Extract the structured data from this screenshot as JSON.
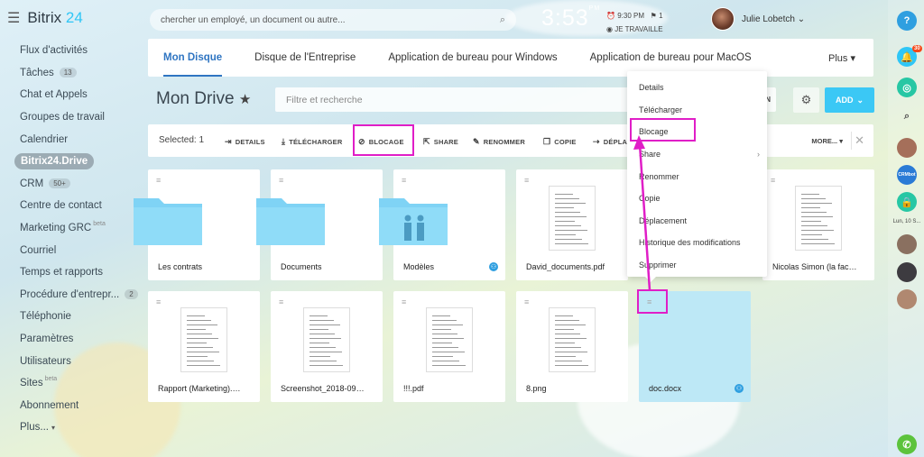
{
  "app": {
    "logo_name": "Bitrix",
    "logo_num": "24"
  },
  "sidebar": {
    "items": [
      {
        "label": "Flux d'activités",
        "badge": ""
      },
      {
        "label": "Tâches",
        "badge": "13"
      },
      {
        "label": "Chat et Appels",
        "badge": ""
      },
      {
        "label": "Groupes de travail",
        "badge": ""
      },
      {
        "label": "Calendrier",
        "badge": ""
      },
      {
        "label": "Bitrix24.Drive",
        "badge": "",
        "active": true
      },
      {
        "label": "CRM",
        "badge": "50+"
      },
      {
        "label": "Centre de contact",
        "badge": ""
      },
      {
        "label": "Marketing GRC",
        "sup": "beta"
      },
      {
        "label": "Courriel",
        "badge": ""
      },
      {
        "label": "Temps et rapports",
        "badge": ""
      },
      {
        "label": "Procédure d'entrepr...",
        "badge": "2"
      },
      {
        "label": "Téléphonie",
        "badge": ""
      },
      {
        "label": "Paramètres",
        "badge": ""
      },
      {
        "label": "Utilisateurs",
        "badge": ""
      },
      {
        "label": "Sites",
        "sup": "beta"
      },
      {
        "label": "Abonnement",
        "badge": ""
      },
      {
        "label": "Plus...",
        "badge": ""
      }
    ]
  },
  "header": {
    "search_placeholder": "chercher un employé, un document ou autre...",
    "clock": "3:53",
    "clock_ampm": "PM",
    "alarm": "9:30 PM",
    "flag_count": "1",
    "status": "JE TRAVAILLE",
    "user_name": "Julie Lobetch"
  },
  "tabs": {
    "items": [
      "Mon Disque",
      "Disque de l'Entreprise",
      "Application de bureau pour Windows",
      "Application de bureau pour MacOS"
    ],
    "more": "Plus"
  },
  "drive": {
    "title": "Mon Drive",
    "filter_placeholder": "Filtre et recherche",
    "filter_suffix": "N",
    "add_label": "ADD"
  },
  "actionbar": {
    "selected": "Selected: 1",
    "details": "DETAILS",
    "download": "TÉLÉCHARGER",
    "lock": "BLOCAGE",
    "share": "SHARE",
    "rename": "RENOMMER",
    "copy": "COPIE",
    "move": "DÉPLA",
    "more": "MORE..."
  },
  "files": [
    {
      "name": "Les contrats",
      "kind": "folder"
    },
    {
      "name": "Documents",
      "kind": "folder"
    },
    {
      "name": "Modèles",
      "kind": "folder-shared"
    },
    {
      "name": "David_documents.pdf",
      "kind": "doc"
    },
    {
      "name": "Nicolas Simon (la facture...",
      "kind": "doc"
    },
    {
      "name": "Rapport (Marketing).doc",
      "kind": "doc"
    },
    {
      "name": "Screenshot_2018-09-10-0...",
      "kind": "doc"
    },
    {
      "name": "!!!.pdf",
      "kind": "doc"
    },
    {
      "name": "8.png",
      "kind": "doc"
    },
    {
      "name": "doc.docx",
      "kind": "doc-selected"
    }
  ],
  "context_menu": {
    "items": [
      "Details",
      "Télécharger",
      "Blocage",
      "Share",
      "Renommer",
      "Copie",
      "Déplacement",
      "Historique des modifications",
      "Supprimer"
    ]
  },
  "rail": {
    "help": "?",
    "notif_badge": "30",
    "date": "Lun, 10 S...",
    "crm": "CRMbot"
  },
  "colors": {
    "accent": "#2f75c2",
    "add_button": "#3bc8f5",
    "highlight": "#e01ec7",
    "folder": "#7fd3f5",
    "selected_card": "#bde8f6"
  }
}
